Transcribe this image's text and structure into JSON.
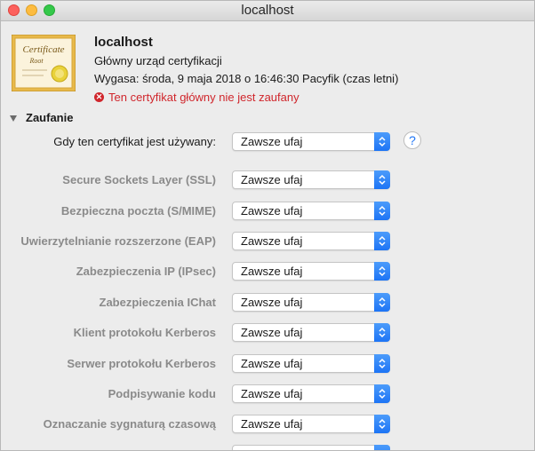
{
  "window": {
    "title": "localhost"
  },
  "header": {
    "name": "localhost",
    "subtitle": "Główny urząd certyfikacji",
    "expiry": "Wygasa: środa, 9 maja 2018 o 16:46:30 Pacyfik (czas letni)",
    "warning": "Ten certyfikat główny nie jest zaufany",
    "icon_text_top": "Certificate",
    "icon_text_bottom": "Root"
  },
  "section": {
    "label": "Zaufanie",
    "expanded": true
  },
  "main_row": {
    "label": "Gdy ten certyfikat jest używany:",
    "value": "Zawsze ufaj"
  },
  "help": {
    "label": "?"
  },
  "rows": [
    {
      "label": "Secure Sockets Layer (SSL)",
      "value": "Zawsze ufaj"
    },
    {
      "label": "Bezpieczna poczta (S/MIME)",
      "value": "Zawsze ufaj"
    },
    {
      "label": "Uwierzytelnianie rozszerzone (EAP)",
      "value": "Zawsze ufaj"
    },
    {
      "label": "Zabezpieczenia IP (IPsec)",
      "value": "Zawsze ufaj"
    },
    {
      "label": "Zabezpieczenia IChat",
      "value": "Zawsze ufaj"
    },
    {
      "label": "Klient protokołu Kerberos",
      "value": "Zawsze ufaj"
    },
    {
      "label": "Serwer protokołu Kerberos",
      "value": "Zawsze ufaj"
    },
    {
      "label": "Podpisywanie kodu",
      "value": "Zawsze ufaj"
    },
    {
      "label": "Oznaczanie sygnaturą czasową",
      "value": "Zawsze ufaj"
    }
  ],
  "colors": {
    "accent": "#1d74f5",
    "warning": "#d0262c"
  }
}
